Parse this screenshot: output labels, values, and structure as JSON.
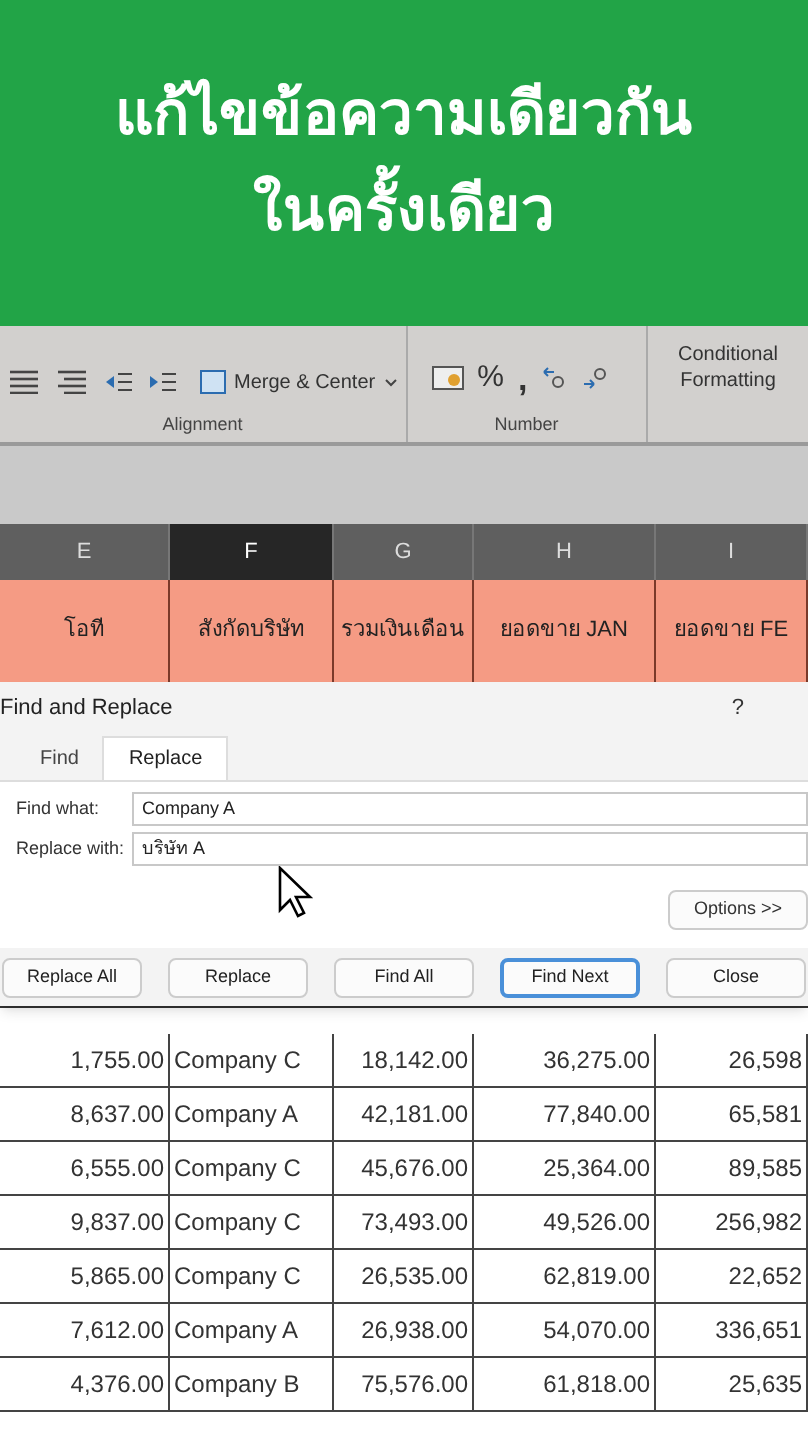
{
  "banner": {
    "title_lines": [
      "แก้ไขข้อความเดียวกัน",
      "ในครั้งเดียว"
    ]
  },
  "ribbon": {
    "merge_button": "Merge & Center",
    "groups": [
      "Alignment",
      "Number"
    ],
    "number_symbols": [
      "%",
      ","
    ],
    "conditional_formatting": "Conditional Formatting"
  },
  "columns": [
    {
      "label": "E",
      "selected": false
    },
    {
      "label": "F",
      "selected": true
    },
    {
      "label": "G",
      "selected": false
    },
    {
      "label": "H",
      "selected": false
    },
    {
      "label": "I",
      "selected": false
    }
  ],
  "header_row": [
    "โอที",
    "สังกัดบริษัท",
    "รวมเงินเดือน",
    "ยอดขาย JAN",
    "ยอดขาย FE"
  ],
  "dialog": {
    "title": "Find and Replace",
    "help": "?",
    "tabs": [
      {
        "label": "Find",
        "selected": false
      },
      {
        "label": "Replace",
        "selected": true
      }
    ],
    "fields": [
      {
        "label": "Find what:",
        "value": "Company A"
      },
      {
        "label": "Replace with:",
        "value": "บริษัท A"
      }
    ],
    "options_button": "Options >>",
    "buttons": [
      {
        "label": "Replace All",
        "focused": false
      },
      {
        "label": "Replace",
        "focused": false
      },
      {
        "label": "Find All",
        "focused": false
      },
      {
        "label": "Find Next",
        "focused": true
      },
      {
        "label": "Close",
        "focused": false
      }
    ]
  },
  "rows": [
    [
      "1,755.00",
      "Company C",
      "18,142.00",
      "36,275.00",
      "26,598"
    ],
    [
      "8,637.00",
      "Company A",
      "42,181.00",
      "77,840.00",
      "65,581"
    ],
    [
      "6,555.00",
      "Company C",
      "45,676.00",
      "25,364.00",
      "89,585"
    ],
    [
      "9,837.00",
      "Company C",
      "73,493.00",
      "49,526.00",
      "256,982"
    ],
    [
      "5,865.00",
      "Company C",
      "26,535.00",
      "62,819.00",
      "22,652"
    ],
    [
      "7,612.00",
      "Company A",
      "26,938.00",
      "54,070.00",
      "336,651"
    ],
    [
      "4,376.00",
      "Company B",
      "75,576.00",
      "61,818.00",
      "25,635"
    ]
  ]
}
